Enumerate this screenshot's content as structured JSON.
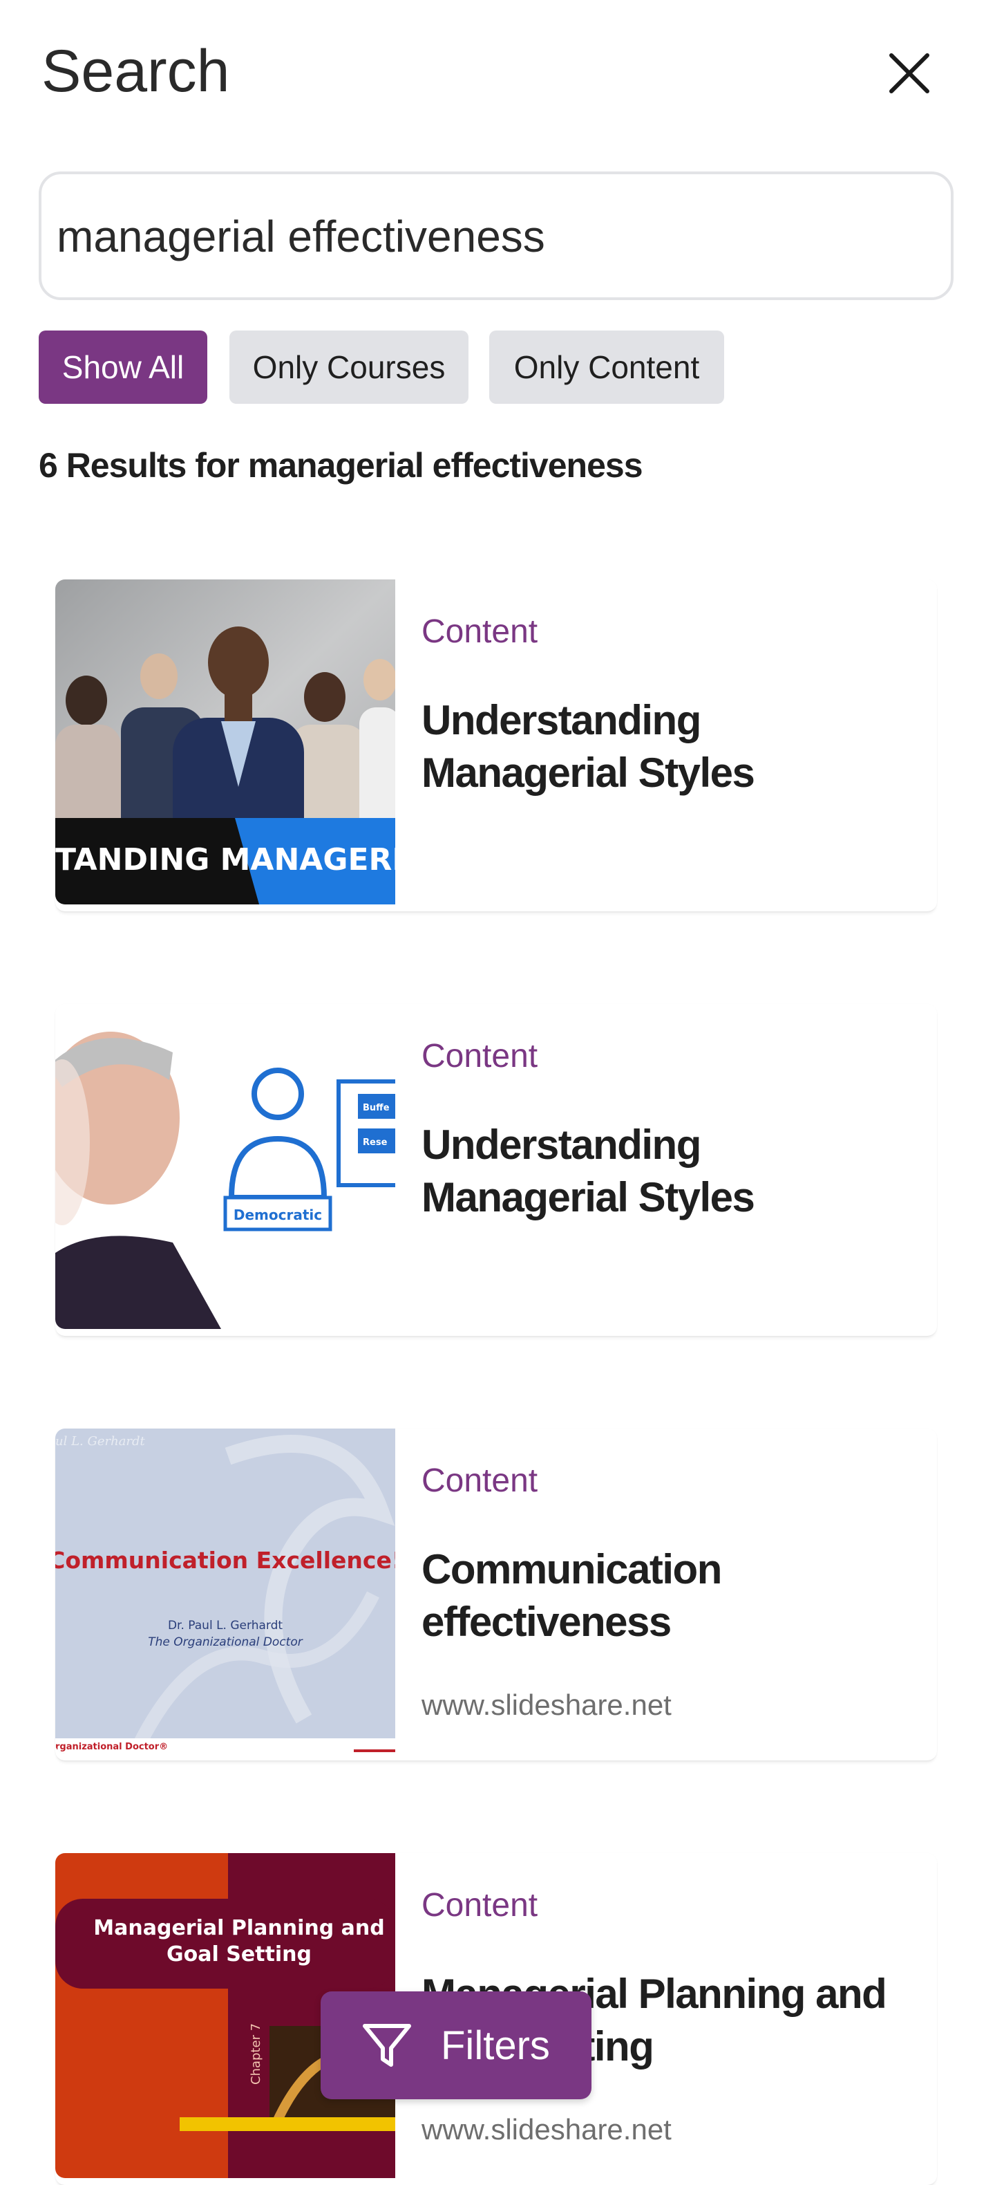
{
  "header": {
    "title": "Search",
    "close_icon": "close-icon"
  },
  "search": {
    "value": "managerial effectiveness",
    "placeholder": ""
  },
  "filter_chips": [
    {
      "label": "Show All",
      "active": true
    },
    {
      "label": "Only Courses",
      "active": false
    },
    {
      "label": "Only Content",
      "active": false
    }
  ],
  "results": {
    "heading": "6 Results for managerial effectiveness",
    "items": [
      {
        "type": "Content",
        "title": "Understanding Managerial Styles",
        "source": "",
        "thumb_banner_text": "TANDING MANAGERIAL ST"
      },
      {
        "type": "Content",
        "title": "Understanding Managerial Styles",
        "source": "",
        "thumb_badge_text": "Democratic",
        "thumb_side_labels": [
          "Buffe",
          "Rese"
        ]
      },
      {
        "type": "Content",
        "title": "Communication effectiveness",
        "source": "www.slideshare.net",
        "thumb_header_text": "Communication Excellence!",
        "thumb_author": "Dr. Paul L. Gerhardt",
        "thumb_author_title": "The Organizational Doctor",
        "thumb_corner_text": "ul L. Gerhardt",
        "thumb_footer_text": "rganizational Doctor®"
      },
      {
        "type": "Content",
        "title": "Managerial Planning and Goal Setting",
        "source": "www.slideshare.net",
        "thumb_title": "Managerial Planning and Goal Setting",
        "thumb_chapter": "Chapter 7"
      }
    ]
  },
  "filters_button": {
    "label": "Filters",
    "icon": "filter-icon"
  },
  "colors": {
    "accent": "#7a3783",
    "chip_idle": "#e1e2e6",
    "source_text": "#6e6e6e"
  }
}
